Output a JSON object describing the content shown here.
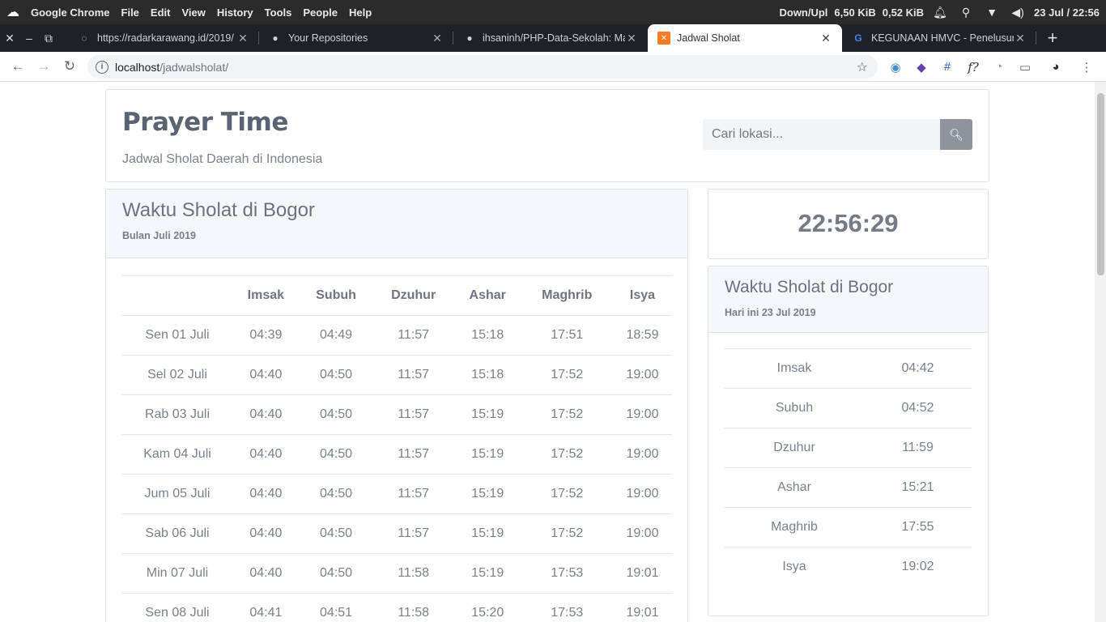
{
  "os": {
    "app_name": "Google Chrome",
    "menu": [
      "File",
      "Edit",
      "View",
      "History",
      "Tools",
      "People",
      "Help"
    ],
    "net_label": "Down/Upl",
    "net_down": "6,50 KiB",
    "net_up": "0,52 KiB",
    "datetime": "23 Jul / 22:56"
  },
  "tabs": [
    {
      "title": "https://radarkarawang.id/2019/",
      "icon": "globe-icon"
    },
    {
      "title": "Your Repositories",
      "icon": "github-icon"
    },
    {
      "title": "ihsaninh/PHP-Data-Sekolah: Mak",
      "icon": "github-icon"
    },
    {
      "title": "Jadwal Sholat",
      "icon": "xampp-icon"
    },
    {
      "title": "KEGUNAAN HMVC - Penelusuran",
      "icon": "google-icon"
    }
  ],
  "address": {
    "host": "localhost",
    "path": "/jadwalsholat/"
  },
  "header": {
    "brand": "Prayer Time",
    "tagline": "Jadwal Sholat Daerah di Indonesia",
    "search_placeholder": "Cari lokasi..."
  },
  "monthly": {
    "title": "Waktu Sholat di Bogor",
    "subtitle": "Bulan Juli 2019",
    "columns": [
      "",
      "Imsak",
      "Subuh",
      "Dzuhur",
      "Ashar",
      "Maghrib",
      "Isya"
    ],
    "rows": [
      {
        "day": "Sen 01 Juli",
        "imsak": "04:39",
        "subuh": "04:49",
        "dzuhur": "11:57",
        "ashar": "15:18",
        "maghrib": "17:51",
        "isya": "18:59"
      },
      {
        "day": "Sel 02 Juli",
        "imsak": "04:40",
        "subuh": "04:50",
        "dzuhur": "11:57",
        "ashar": "15:18",
        "maghrib": "17:52",
        "isya": "19:00"
      },
      {
        "day": "Rab 03 Juli",
        "imsak": "04:40",
        "subuh": "04:50",
        "dzuhur": "11:57",
        "ashar": "15:19",
        "maghrib": "17:52",
        "isya": "19:00"
      },
      {
        "day": "Kam 04 Juli",
        "imsak": "04:40",
        "subuh": "04:50",
        "dzuhur": "11:57",
        "ashar": "15:19",
        "maghrib": "17:52",
        "isya": "19:00"
      },
      {
        "day": "Jum 05 Juli",
        "imsak": "04:40",
        "subuh": "04:50",
        "dzuhur": "11:57",
        "ashar": "15:19",
        "maghrib": "17:52",
        "isya": "19:00"
      },
      {
        "day": "Sab 06 Juli",
        "imsak": "04:40",
        "subuh": "04:50",
        "dzuhur": "11:57",
        "ashar": "15:19",
        "maghrib": "17:52",
        "isya": "19:00"
      },
      {
        "day": "Min 07 Juli",
        "imsak": "04:40",
        "subuh": "04:50",
        "dzuhur": "11:58",
        "ashar": "15:19",
        "maghrib": "17:53",
        "isya": "19:01"
      },
      {
        "day": "Sen 08 Juli",
        "imsak": "04:41",
        "subuh": "04:51",
        "dzuhur": "11:58",
        "ashar": "15:20",
        "maghrib": "17:53",
        "isya": "19:01"
      }
    ]
  },
  "clock": {
    "time": "22:56:29"
  },
  "today": {
    "title": "Waktu Sholat di Bogor",
    "subtitle": "Hari ini 23 Jul 2019",
    "rows": [
      {
        "name": "Imsak",
        "time": "04:42"
      },
      {
        "name": "Subuh",
        "time": "04:52"
      },
      {
        "name": "Dzuhur",
        "time": "11:59"
      },
      {
        "name": "Ashar",
        "time": "15:21"
      },
      {
        "name": "Maghrib",
        "time": "17:55"
      },
      {
        "name": "Isya",
        "time": "19:02"
      }
    ]
  }
}
